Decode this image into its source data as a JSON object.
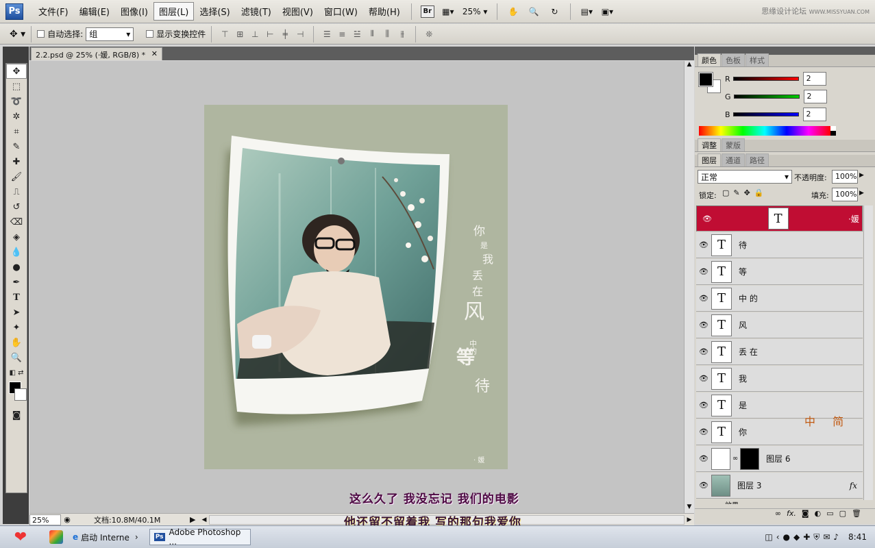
{
  "app": {
    "logo": "Ps"
  },
  "menubar": {
    "items": [
      "文件(F)",
      "编辑(E)",
      "图像(I)",
      "图层(L)",
      "选择(S)",
      "滤镜(T)",
      "视图(V)",
      "窗口(W)",
      "帮助(H)"
    ],
    "bridge_label": "Br",
    "zoom": "25%",
    "watermark": "思缘设计论坛",
    "watermark_url": "WWW.MISSYUAN.COM"
  },
  "options_bar": {
    "auto_select_label": "自动选择:",
    "auto_select_value": "组",
    "show_transform_label": "显示变换控件"
  },
  "document": {
    "tab_title": "2.2.psd @ 25% (·媛, RGB/8) *",
    "status_zoom": "25%",
    "status_doc": "文档:10.8M/40.1M"
  },
  "artwork": {
    "poem": [
      "你",
      "是",
      "我",
      "丢",
      "在",
      "风",
      "中的",
      "等",
      "待"
    ],
    "signature": "· 媛"
  },
  "color_panel": {
    "tabs": [
      "颜色",
      "色板",
      "样式"
    ],
    "r_label": "R",
    "g_label": "G",
    "b_label": "B",
    "r": "2",
    "g": "2",
    "b": "2"
  },
  "adjust_panel": {
    "tabs": [
      "调整",
      "蒙版"
    ]
  },
  "layers_panel": {
    "tabs": [
      "图层",
      "通道",
      "路径"
    ],
    "blend_mode": "正常",
    "opacity_label": "不透明度:",
    "opacity": "100%",
    "lock_label": "锁定:",
    "fill_label": "填充:",
    "fill": "100%",
    "layers": [
      {
        "name": "·媛",
        "type": "text",
        "selected": true
      },
      {
        "name": "待",
        "type": "text"
      },
      {
        "name": "等",
        "type": "text"
      },
      {
        "name": "中 的",
        "type": "text"
      },
      {
        "name": "风",
        "type": "text"
      },
      {
        "name": "丢 在",
        "type": "text"
      },
      {
        "name": "我",
        "type": "text"
      },
      {
        "name": "是",
        "type": "text"
      },
      {
        "name": "你",
        "type": "text"
      },
      {
        "name": "图层 6",
        "type": "masked"
      },
      {
        "name": "图层 3",
        "type": "image",
        "fx": "fx"
      }
    ],
    "effects_label": "效果",
    "deco_text": "中 简"
  },
  "subtitles": {
    "line1": "这么久了 我没忘记 我们的电影",
    "line2": "他还留不留着我 写的那句我爱你"
  },
  "taskbar": {
    "ie_label": "启动 Interne",
    "ps_label": "Adobe Photoshop ...",
    "clock": "8:41"
  }
}
